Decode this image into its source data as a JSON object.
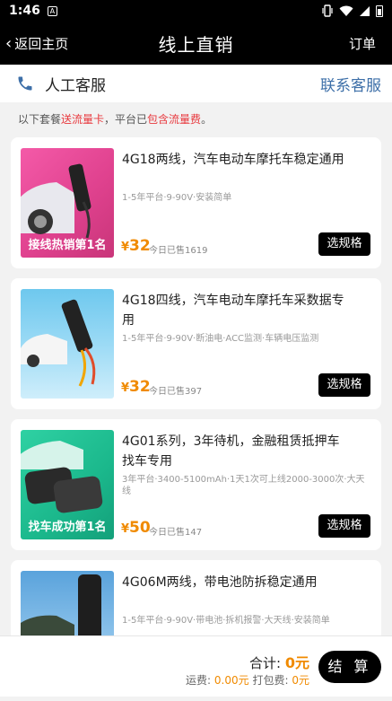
{
  "status_bar": {
    "time": "1:46",
    "notification_glyph": "A"
  },
  "nav": {
    "back_label": "返回主页",
    "title": "线上直销",
    "order_label": "订单"
  },
  "service": {
    "label": "人工客服",
    "link": "联系客服",
    "icon": "phone-icon"
  },
  "notice": {
    "prefix": "以下套餐",
    "highlight1": "送流量卡",
    "middle": "，平台已",
    "highlight2": "包含流量费",
    "suffix": "。"
  },
  "products": [
    {
      "title": "4G18两线，汽车电动车摩托车稳定通用",
      "spec": "1-5年平台·9-90V·安装简单",
      "price_symbol": "¥",
      "price": "32",
      "sold": "今日已售1619",
      "button": "选规格",
      "badge": "接线热销第1名"
    },
    {
      "title": "4G18四线，汽车电动车摩托车采数据专用",
      "spec": "1-5年平台·9-90V·断油电·ACC监测·车辆电压监测",
      "price_symbol": "¥",
      "price": "32",
      "sold": "今日已售397",
      "button": "选规格",
      "badge": ""
    },
    {
      "title": "4G01系列，3年待机，金融租赁抵押车找车专用",
      "spec": "3年平台·3400-5100mAh·1天1次可上线2000-3000次·大天线",
      "price_symbol": "¥",
      "price": "50",
      "sold": "今日已售147",
      "button": "选规格",
      "badge": "找车成功第1名"
    },
    {
      "title": "4G06M两线，带电池防拆稳定通用",
      "spec": "1-5年平台·9-90V·带电池·拆机报警·大天线·安装简单",
      "price_symbol": "",
      "price": "",
      "sold": "",
      "button": "",
      "badge": ""
    }
  ],
  "footer": {
    "total_label": "合计:",
    "total_value": "0元",
    "shipping_label": "运费:",
    "shipping_value": "0.00元",
    "packing_label": "打包费:",
    "packing_value": "0元",
    "checkout_label": "结 算"
  },
  "colors": {
    "accent": "#f08a00",
    "highlight": "#e8383d",
    "link": "#3d6fa8",
    "primary": "#000000"
  }
}
